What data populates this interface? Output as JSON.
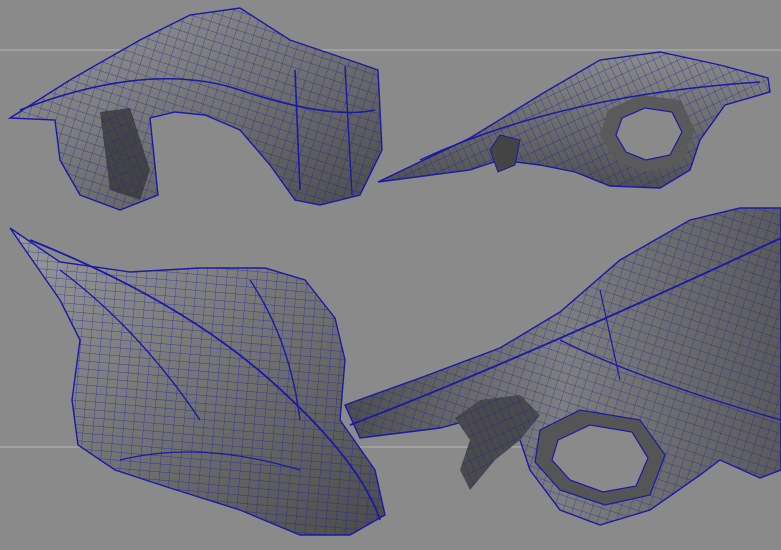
{
  "scene": {
    "colors": {
      "background": "#8a8a8a",
      "horizon_line": "#b5b5b5",
      "mesh_light": "#8f8f8f",
      "mesh_mid": "#6f6f6f",
      "mesh_dark": "#4a4a4a",
      "mesh_shadow": "#353535",
      "wireframe": "#1a1aa6"
    },
    "panels": [
      {
        "name": "top-left-view",
        "subject": "mesh-front-view"
      },
      {
        "name": "top-right-view",
        "subject": "mesh-side-view"
      },
      {
        "name": "bottom-left-view",
        "subject": "mesh-top-view"
      },
      {
        "name": "bottom-right-view",
        "subject": "mesh-closeup-view"
      }
    ]
  }
}
